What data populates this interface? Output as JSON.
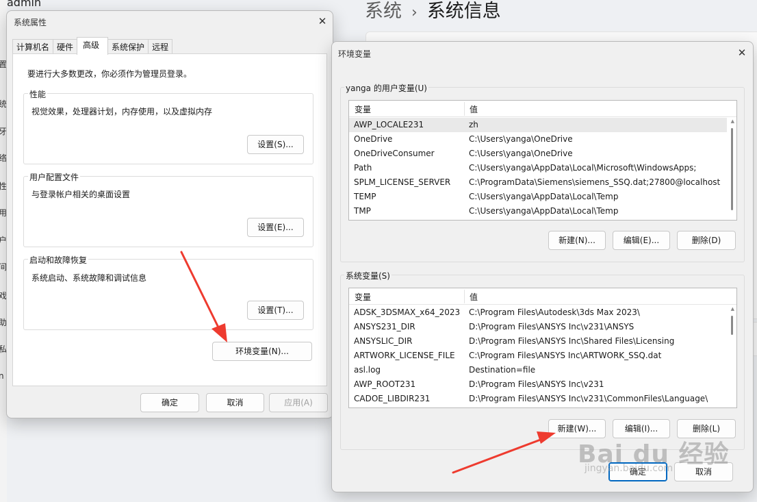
{
  "background": {
    "admin_text": "admin",
    "breadcrumb_parent": "系统",
    "breadcrumb_sep": "›",
    "breadcrumb_current": "系统信息",
    "left_chars": [
      "置",
      "统",
      "牙",
      "络",
      "性",
      "用",
      "户",
      "间",
      "戏",
      "助",
      "私",
      "n"
    ]
  },
  "sys_props": {
    "title": "系统属性",
    "close_icon": "✕",
    "tabs": [
      "计算机名",
      "硬件",
      "高级",
      "系统保护",
      "远程"
    ],
    "active_tab": "高级",
    "notice": "要进行大多数更改，你必须作为管理员登录。",
    "performance": {
      "label": "性能",
      "desc": "视觉效果，处理器计划，内存使用，以及虚拟内存",
      "button": "设置(S)..."
    },
    "user_profile": {
      "label": "用户配置文件",
      "desc": "与登录帐户相关的桌面设置",
      "button": "设置(E)..."
    },
    "startup": {
      "label": "启动和故障恢复",
      "desc": "系统启动、系统故障和调试信息",
      "button": "设置(T)..."
    },
    "env_button": "环境变量(N)...",
    "ok": "确定",
    "cancel": "取消",
    "apply": "应用(A)"
  },
  "env_vars": {
    "title": "环境变量",
    "close_icon": "✕",
    "user_section_label": "yanga 的用户变量(U)",
    "sys_section_label": "系统变量(S)",
    "col_variable": "变量",
    "col_value": "值",
    "user_vars": [
      {
        "name": "AWP_LOCALE231",
        "value": "zh"
      },
      {
        "name": "OneDrive",
        "value": "C:\\Users\\yanga\\OneDrive"
      },
      {
        "name": "OneDriveConsumer",
        "value": "C:\\Users\\yanga\\OneDrive"
      },
      {
        "name": "Path",
        "value": "C:\\Users\\yanga\\AppData\\Local\\Microsoft\\WindowsApps;"
      },
      {
        "name": "SPLM_LICENSE_SERVER",
        "value": "C:\\ProgramData\\Siemens\\siemens_SSQ.dat;27800@localhost"
      },
      {
        "name": "TEMP",
        "value": "C:\\Users\\yanga\\AppData\\Local\\Temp"
      },
      {
        "name": "TMP",
        "value": "C:\\Users\\yanga\\AppData\\Local\\Temp"
      }
    ],
    "sys_vars": [
      {
        "name": "ADSK_3DSMAX_x64_2023",
        "value": "C:\\Program Files\\Autodesk\\3ds Max 2023\\"
      },
      {
        "name": "ANSYS231_DIR",
        "value": "D:\\Program Files\\ANSYS Inc\\v231\\ANSYS"
      },
      {
        "name": "ANSYSLIC_DIR",
        "value": "D:\\Program Files\\ANSYS Inc\\Shared Files\\Licensing"
      },
      {
        "name": "ARTWORK_LICENSE_FILE",
        "value": "C:\\Program Files\\ANSYS Inc\\ARTWORK_SSQ.dat"
      },
      {
        "name": "asl.log",
        "value": "Destination=file"
      },
      {
        "name": "AWP_ROOT231",
        "value": "D:\\Program Files\\ANSYS Inc\\v231"
      },
      {
        "name": "CADOE_LIBDIR231",
        "value": "D:\\Program Files\\ANSYS Inc\\v231\\CommonFiles\\Language\\"
      }
    ],
    "user_new": "新建(N)...",
    "user_edit": "编辑(E)...",
    "user_delete": "删除(D)",
    "sys_new": "新建(W)...",
    "sys_edit": "编辑(I)...",
    "sys_delete": "删除(L)",
    "ok": "确定",
    "cancel": "取消"
  },
  "watermark": {
    "main": "Bai du 经验",
    "sub": "jingyan.baidu.com"
  },
  "colors": {
    "arrow": "#ee3b2f",
    "accent": "#0067c0"
  }
}
